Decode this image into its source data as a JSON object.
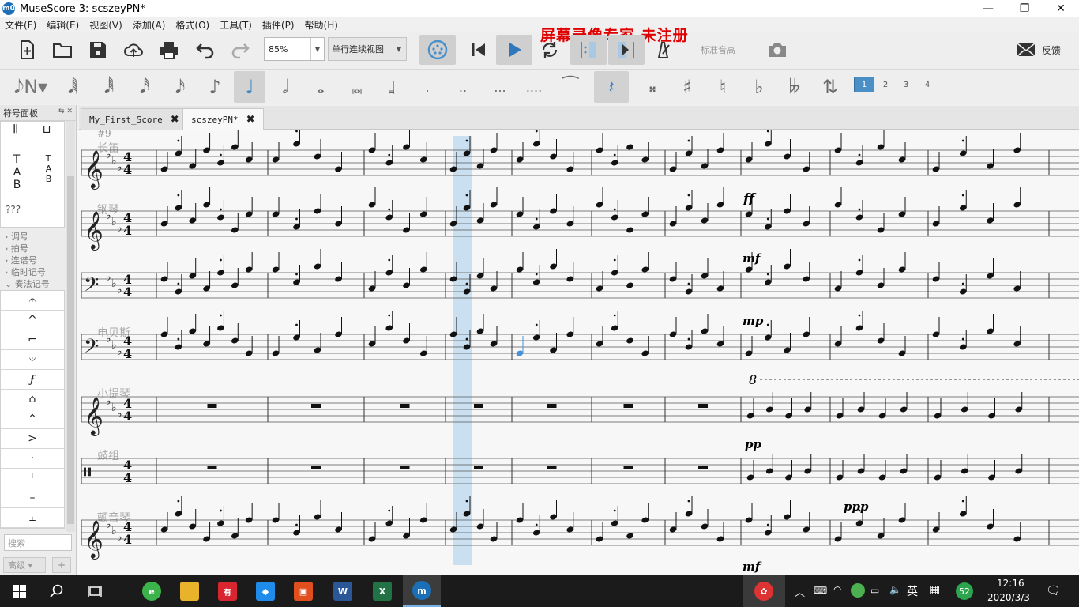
{
  "window": {
    "title": "MuseScore 3: scszeyPN*",
    "logo_text": "mū",
    "minimize_glyph": "—",
    "maximize_glyph": "❐",
    "close_glyph": "✕"
  },
  "menu": [
    "文件(F)",
    "编辑(E)",
    "视图(V)",
    "添加(A)",
    "格式(O)",
    "工具(T)",
    "插件(P)",
    "帮助(H)"
  ],
  "toolbar": {
    "zoom_value": "85%",
    "view_mode": "单行连续视图",
    "watermark": "屏幕录像专家  未注册",
    "concert_pitch_label": "标准音高",
    "feedback_label": "反馈",
    "icons": [
      "new-file-icon",
      "open-folder-icon",
      "save-icon",
      "cloud-upload-icon",
      "print-icon",
      "undo-icon",
      "redo-icon",
      "midi-input-icon",
      "rewind-icon",
      "play-icon",
      "loop-icon",
      "loop-in-icon",
      "loop-out-icon",
      "metronome-icon",
      "camera-icon",
      "envelope-icon"
    ]
  },
  "note_input": {
    "voices": [
      "1",
      "2",
      "3",
      "4"
    ],
    "active_voice": "1",
    "dots": [
      ".",
      "..",
      "...",
      "...."
    ]
  },
  "palette": {
    "title": "符号面板",
    "unknown_label": "???",
    "sections": [
      "调号",
      "拍号",
      "连谱号",
      "临时记号",
      "奏法记号"
    ],
    "articulation_glyphs": [
      "𝄐",
      "^",
      "⌐",
      "𝄑",
      "𝆑",
      "⌂",
      "⌃",
      ">",
      "·",
      "ᛌ",
      "–",
      "⫠"
    ],
    "search_placeholder": "搜索",
    "advanced_label": "高级",
    "add_label": "+"
  },
  "tabs": [
    {
      "label": "My_First_Score",
      "close": "✖",
      "active": false
    },
    {
      "label": "scszeyPN*",
      "close": "✖",
      "active": true
    }
  ],
  "score": {
    "measure_number": "#9",
    "instruments": [
      "长笛",
      "钢琴",
      "",
      "电贝斯",
      "小提琴",
      "鼓组",
      "颤音琴"
    ],
    "dynamics": [
      "ff",
      "mf",
      "mp",
      "pp",
      "ppp",
      "mf"
    ],
    "ottava": "8",
    "selection_color": "#b7d6ec",
    "accent_note_color": "#4a90d9"
  },
  "taskbar": {
    "input_method": "英",
    "notification_badge": "52",
    "time": "12:16",
    "date": "2020/3/3"
  }
}
